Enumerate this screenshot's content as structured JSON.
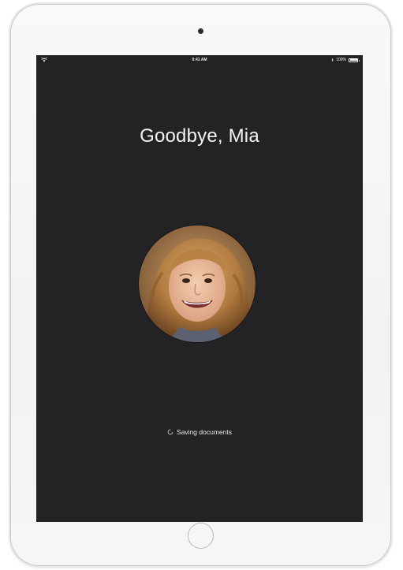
{
  "status_bar": {
    "time": "9:41 AM",
    "battery_label": "100%",
    "battery_level": 1.0
  },
  "screen": {
    "title": "Goodbye, Mia",
    "status_text": "Saving documents"
  },
  "colors": {
    "screen_background": "#232225",
    "text": "#ffffff",
    "device_body": "#f4f4f4"
  },
  "icons": [
    "camera-icon",
    "wifi-icon",
    "bluetooth-icon",
    "battery-icon",
    "spinner-icon",
    "home-button-icon"
  ]
}
